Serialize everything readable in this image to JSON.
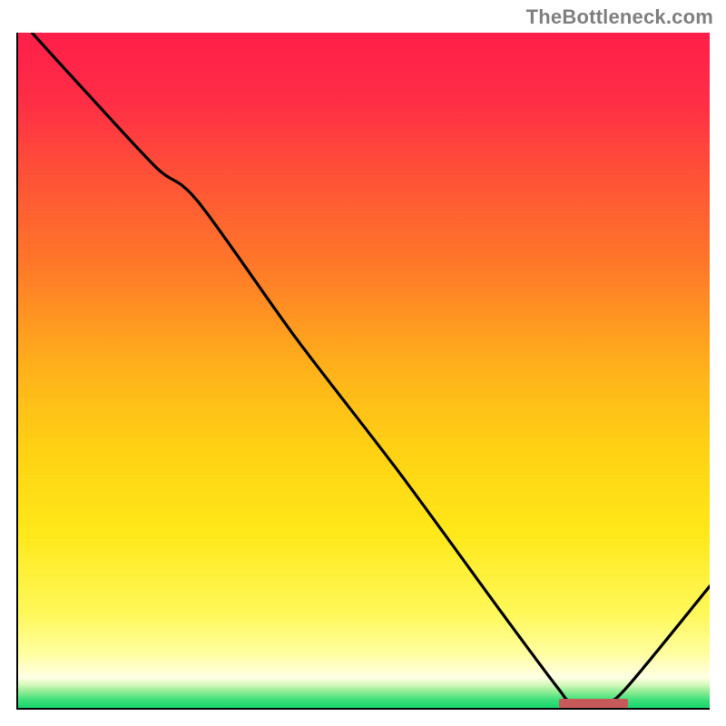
{
  "watermark": {
    "text": "TheBottleneck.com"
  },
  "colors": {
    "axis": "#000000",
    "curve": "#000000",
    "marker": "#c65a5b",
    "gradient_stops": [
      {
        "offset": 0.0,
        "color": "#ff1f49"
      },
      {
        "offset": 0.1,
        "color": "#ff2d46"
      },
      {
        "offset": 0.22,
        "color": "#ff5436"
      },
      {
        "offset": 0.35,
        "color": "#ff7a28"
      },
      {
        "offset": 0.5,
        "color": "#ffb21a"
      },
      {
        "offset": 0.62,
        "color": "#ffd214"
      },
      {
        "offset": 0.74,
        "color": "#ffe819"
      },
      {
        "offset": 0.86,
        "color": "#fff85a"
      },
      {
        "offset": 0.92,
        "color": "#fffea0"
      },
      {
        "offset": 0.955,
        "color": "#ffffe6"
      },
      {
        "offset": 0.965,
        "color": "#d9f9bf"
      },
      {
        "offset": 0.975,
        "color": "#97ee97"
      },
      {
        "offset": 0.988,
        "color": "#3fe07a"
      },
      {
        "offset": 1.0,
        "color": "#17d56b"
      }
    ]
  },
  "chart_data": {
    "type": "line",
    "title": "",
    "xlabel": "",
    "ylabel": "",
    "xlim": [
      0,
      100
    ],
    "ylim": [
      0,
      100
    ],
    "grid": false,
    "legend": false,
    "x": [
      2,
      10,
      20,
      26,
      40,
      55,
      70,
      78,
      80,
      85,
      88,
      100
    ],
    "values": [
      100,
      91,
      80,
      75,
      55,
      35,
      14,
      3,
      1,
      1,
      3,
      18
    ],
    "marker": {
      "x_start": 78,
      "x_end": 88,
      "y": 1
    }
  }
}
